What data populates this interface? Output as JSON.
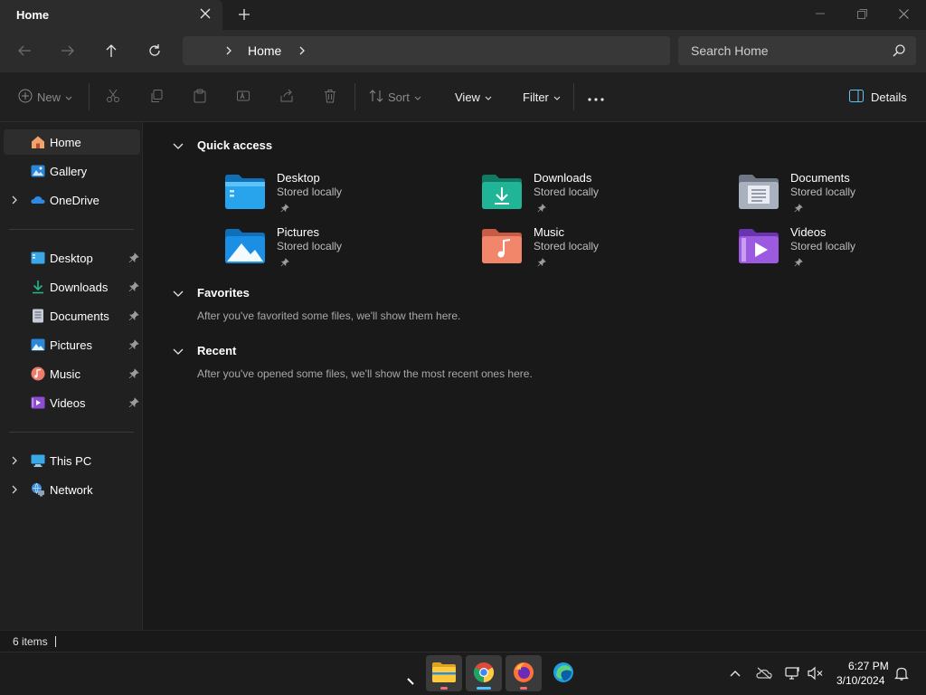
{
  "window": {
    "tab_title": "Home",
    "new_tab_icon": "plus-icon",
    "controls": [
      "minimize-icon",
      "maximize-icon",
      "close-icon"
    ]
  },
  "address": {
    "breadcrumb": "Home",
    "search_placeholder": "Search Home"
  },
  "commandbar": {
    "new_label": "New",
    "sort_label": "Sort",
    "view_label": "View",
    "filter_label": "Filter",
    "more_label": "•••",
    "details_label": "Details"
  },
  "sidebar": {
    "top_items": [
      {
        "label": "Home",
        "icon": "home-icon",
        "selected": true
      },
      {
        "label": "Gallery",
        "icon": "gallery-icon"
      },
      {
        "label": "OneDrive",
        "icon": "onedrive-icon",
        "expandable": true
      }
    ],
    "pinned_items": [
      {
        "label": "Desktop",
        "icon": "desktop-icon"
      },
      {
        "label": "Downloads",
        "icon": "downloads-icon"
      },
      {
        "label": "Documents",
        "icon": "documents-icon"
      },
      {
        "label": "Pictures",
        "icon": "pictures-icon"
      },
      {
        "label": "Music",
        "icon": "music-icon"
      },
      {
        "label": "Videos",
        "icon": "videos-icon"
      }
    ],
    "bottom_items": [
      {
        "label": "This PC",
        "icon": "this-pc-icon",
        "expandable": true
      },
      {
        "label": "Network",
        "icon": "network-icon",
        "expandable": true
      }
    ]
  },
  "content": {
    "quick_access": {
      "title": "Quick access",
      "items": [
        {
          "name": "Desktop",
          "subtitle": "Stored locally",
          "icon": "desktop-folder-icon"
        },
        {
          "name": "Downloads",
          "subtitle": "Stored locally",
          "icon": "downloads-folder-icon"
        },
        {
          "name": "Documents",
          "subtitle": "Stored locally",
          "icon": "documents-folder-icon"
        },
        {
          "name": "Pictures",
          "subtitle": "Stored locally",
          "icon": "pictures-folder-icon"
        },
        {
          "name": "Music",
          "subtitle": "Stored locally",
          "icon": "music-folder-icon"
        },
        {
          "name": "Videos",
          "subtitle": "Stored locally",
          "icon": "videos-folder-icon"
        }
      ]
    },
    "favorites": {
      "title": "Favorites",
      "empty_text": "After you've favorited some files, we'll show them here."
    },
    "recent": {
      "title": "Recent",
      "empty_text": "After you've opened some files, we'll show the most recent ones here."
    }
  },
  "statusbar": {
    "item_count": "6 items"
  },
  "taskbar": {
    "apps": [
      {
        "name": "File Explorer",
        "icon": "file-explorer-icon",
        "active": true
      },
      {
        "name": "Google Chrome",
        "icon": "chrome-icon",
        "active": true
      },
      {
        "name": "Firefox",
        "icon": "firefox-icon",
        "active": true
      },
      {
        "name": "Microsoft Edge",
        "icon": "edge-icon",
        "active": false
      }
    ],
    "clock_time": "6:27 PM",
    "clock_date": "3/10/2024"
  },
  "colors": {
    "accent": "#4cc2ff",
    "folder_blue": "#1a9bf0",
    "downloads_green": "#1fb596",
    "music_orange": "#f1866b",
    "videos_purple": "#9b5ae0"
  }
}
